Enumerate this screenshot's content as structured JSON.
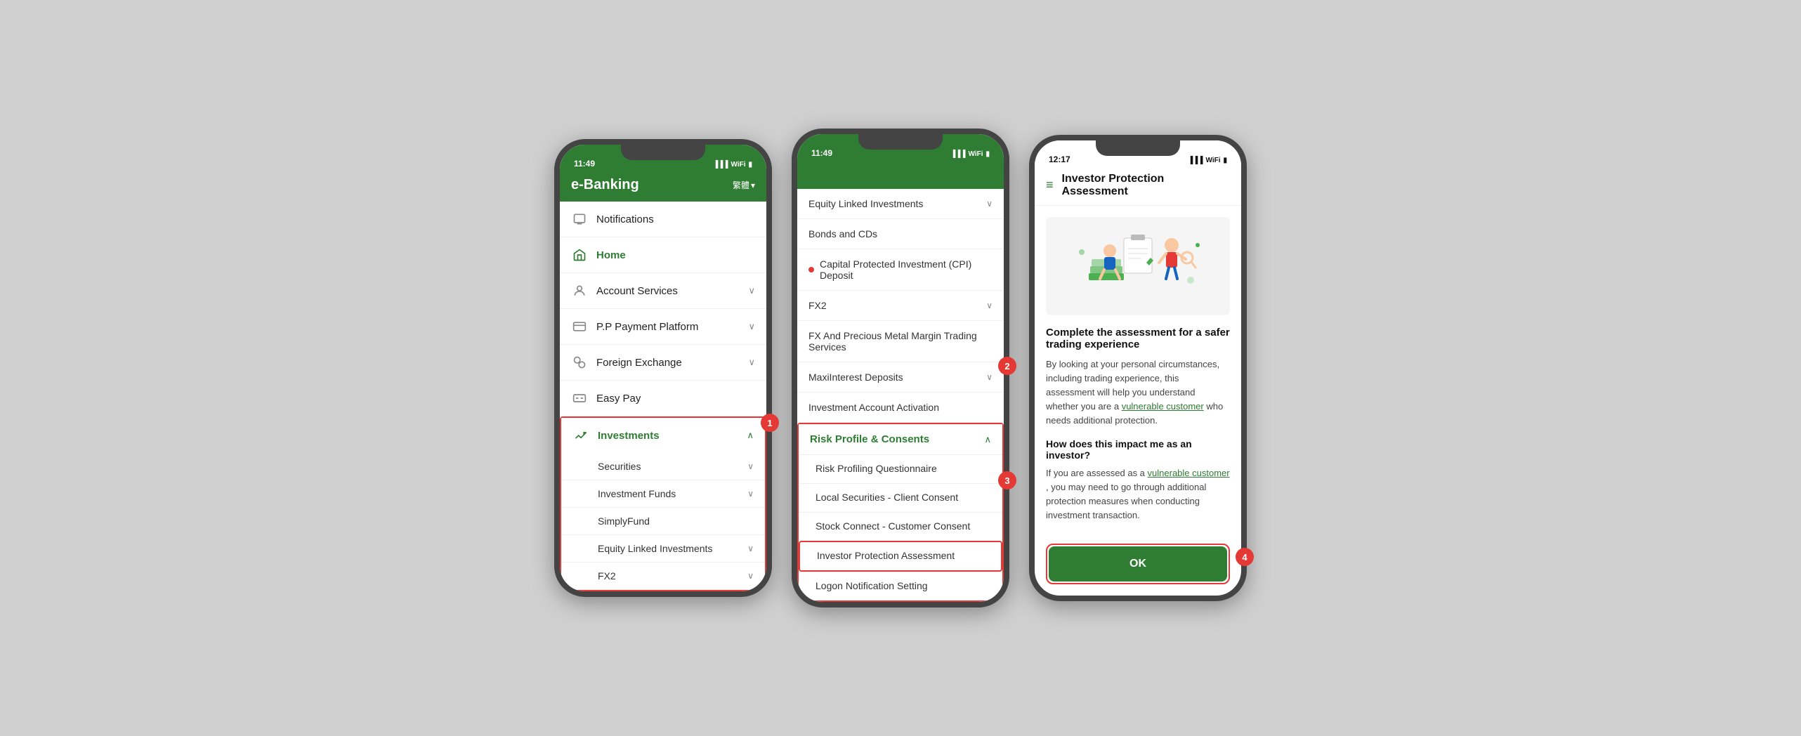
{
  "phones": {
    "phone1": {
      "status_time": "11:49",
      "header": {
        "title": "e-Banking",
        "lang": "繁體",
        "chevron": "▾"
      },
      "menu_items": [
        {
          "id": "notifications",
          "icon": "🔔",
          "label": "Notifications",
          "chevron": ""
        },
        {
          "id": "home",
          "icon": "🏠",
          "label": "Home",
          "active": true
        },
        {
          "id": "account-services",
          "icon": "👤",
          "label": "Account Services",
          "chevron": "∨"
        },
        {
          "id": "pp-payment",
          "icon": "💳",
          "label": "P.P Payment Platform",
          "chevron": "∨"
        },
        {
          "id": "foreign-exchange",
          "icon": "💱",
          "label": "Foreign Exchange",
          "chevron": "∨"
        },
        {
          "id": "easy-pay",
          "icon": "💰",
          "label": "Easy Pay"
        }
      ],
      "investments": {
        "label": "Investments",
        "chevron": "∧",
        "sub_items": [
          {
            "label": "Securities",
            "chevron": "∨"
          },
          {
            "label": "Investment Funds",
            "chevron": "∨"
          },
          {
            "label": "SimplyFund"
          },
          {
            "label": "Equity Linked Investments",
            "chevron": "∨"
          },
          {
            "label": "FX2",
            "chevron": "∨"
          }
        ]
      },
      "badge": "1"
    },
    "phone2": {
      "status_time": "11:49",
      "items": [
        {
          "label": "Equity Linked Investments",
          "chevron": "∨",
          "has_dot": false
        },
        {
          "label": "Bonds and CDs",
          "has_dot": false
        },
        {
          "label": "Capital Protected Investment (CPI) Deposit",
          "has_dot": true
        },
        {
          "label": "FX2",
          "chevron": "∨",
          "has_dot": false
        },
        {
          "label": "FX And Precious Metal Margin Trading Services",
          "has_dot": false
        },
        {
          "label": "MaxiInterest Deposits",
          "chevron": "∨",
          "has_dot": false
        },
        {
          "label": "Investment Account Activation",
          "has_dot": false
        }
      ],
      "risk_section": {
        "label": "Risk Profile & Consents",
        "chevron": "∧",
        "sub_items": [
          {
            "label": "Risk Profiling Questionnaire"
          },
          {
            "label": "Local Securities - Client Consent"
          },
          {
            "label": "Stock Connect - Customer Consent"
          },
          {
            "label": "Investor Protection Assessment",
            "highlighted": true
          },
          {
            "label": "Logon Notification Setting"
          }
        ]
      },
      "badge": "2",
      "badge3": "3"
    },
    "phone3": {
      "status_time": "12:17",
      "header": {
        "title": "Investor Protection Assessment",
        "hamburger": "≡"
      },
      "content": {
        "heading1": "Complete the assessment for a safer trading experience",
        "para1_before": "By looking at your personal circumstances, including trading experience, this assessment will help you understand whether you are a ",
        "para1_link": "vulnerable customer",
        "para1_after": " who needs additional protection.",
        "heading2": "How does this impact me as an investor?",
        "para2_before": "If you are assessed as a ",
        "para2_link": "vulnerable customer",
        "para2_after": " , you may need to go through additional protection measures when conducting investment transaction.",
        "ok_label": "OK"
      },
      "badge": "4"
    }
  },
  "annotations": {
    "1": "1",
    "2": "2",
    "3": "3",
    "4": "4"
  }
}
